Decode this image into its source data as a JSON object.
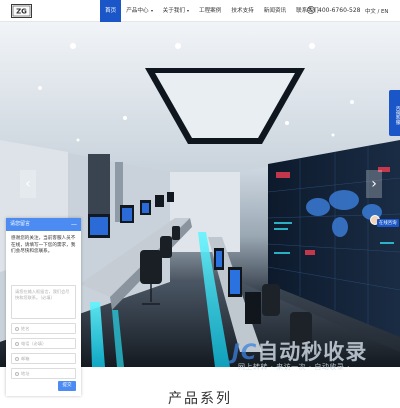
{
  "header": {
    "logo_text": "ZG",
    "nav": [
      {
        "label": "首页",
        "active": true,
        "caret": false
      },
      {
        "label": "产品中心",
        "active": false,
        "caret": true
      },
      {
        "label": "关于我们",
        "active": false,
        "caret": true
      },
      {
        "label": "工程案例",
        "active": false,
        "caret": false
      },
      {
        "label": "技术支持",
        "active": false,
        "caret": false
      },
      {
        "label": "新闻资讯",
        "active": false,
        "caret": false
      },
      {
        "label": "联系我们",
        "active": false,
        "caret": false
      }
    ],
    "phone": "400-6760-528",
    "phone_icon": "phone-icon",
    "language": "中文 / EN"
  },
  "hero": {
    "prev_icon": "‹",
    "next_icon": "›",
    "side_tab": "咨询客服",
    "service_label": "在线咨询"
  },
  "chat": {
    "title": "请您留言",
    "minimize": "—",
    "message": "感谢您的关注，当前客服人员不在线，请填写一下您的需求，我们会尽快和您联系。",
    "textarea_placeholder": "请您在输入框留言，我们会尽快和您联系。（必填）",
    "fields": [
      {
        "placeholder": "姓名"
      },
      {
        "placeholder": "电话（必填）"
      },
      {
        "placeholder": "邮箱"
      },
      {
        "placeholder": "地址"
      }
    ],
    "submit_label": "提交"
  },
  "watermark": {
    "title_prefix": "JC",
    "title_text": "自动秒收录",
    "subtitle": "网上转转 · 来访一次 · 自动收录 ·"
  },
  "section": {
    "title": "产品系列"
  },
  "colors": {
    "brand_blue": "#1a56c8",
    "chat_blue": "#4c8cf2"
  }
}
